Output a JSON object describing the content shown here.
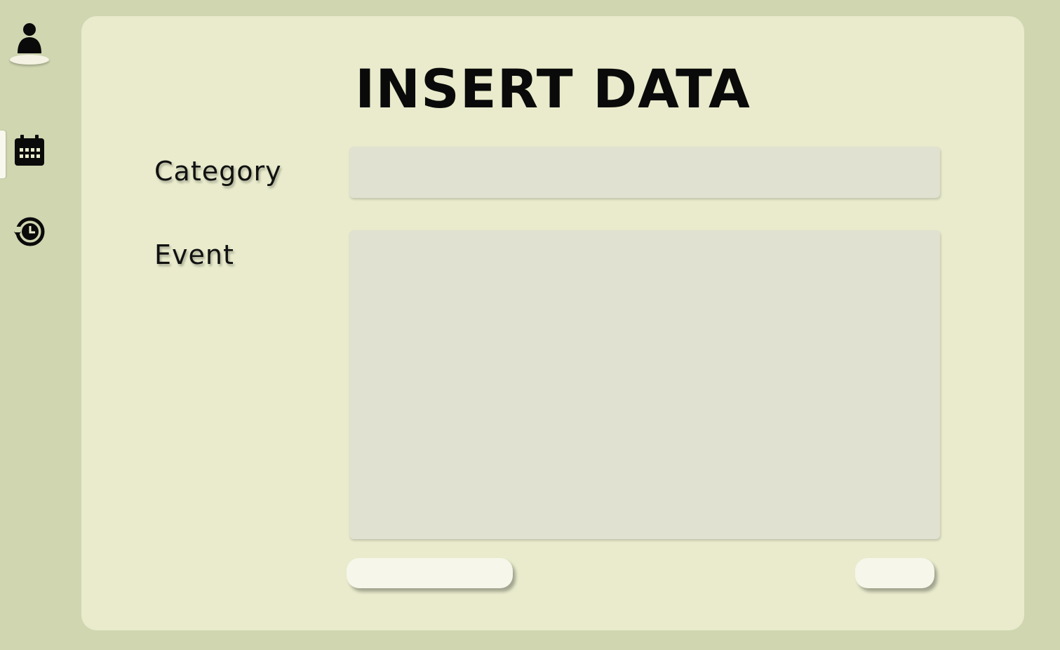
{
  "page": {
    "title": "INSERT DATA"
  },
  "sidebar": {
    "items": [
      {
        "icon": "user-icon",
        "active": false
      },
      {
        "icon": "calendar-icon",
        "active": true
      },
      {
        "icon": "history-icon",
        "active": false
      }
    ]
  },
  "form": {
    "category_label": "Category",
    "category_value": "",
    "category_placeholder": "",
    "event_label": "Event",
    "event_value": "",
    "event_placeholder": "",
    "left_button_label": "",
    "right_button_label": ""
  },
  "colors": {
    "background": "#cfd6b0",
    "panel": "#e9ebcc",
    "field": "#e0e1d0",
    "button": "#f6f6ea",
    "text": "#0a0a0a"
  }
}
